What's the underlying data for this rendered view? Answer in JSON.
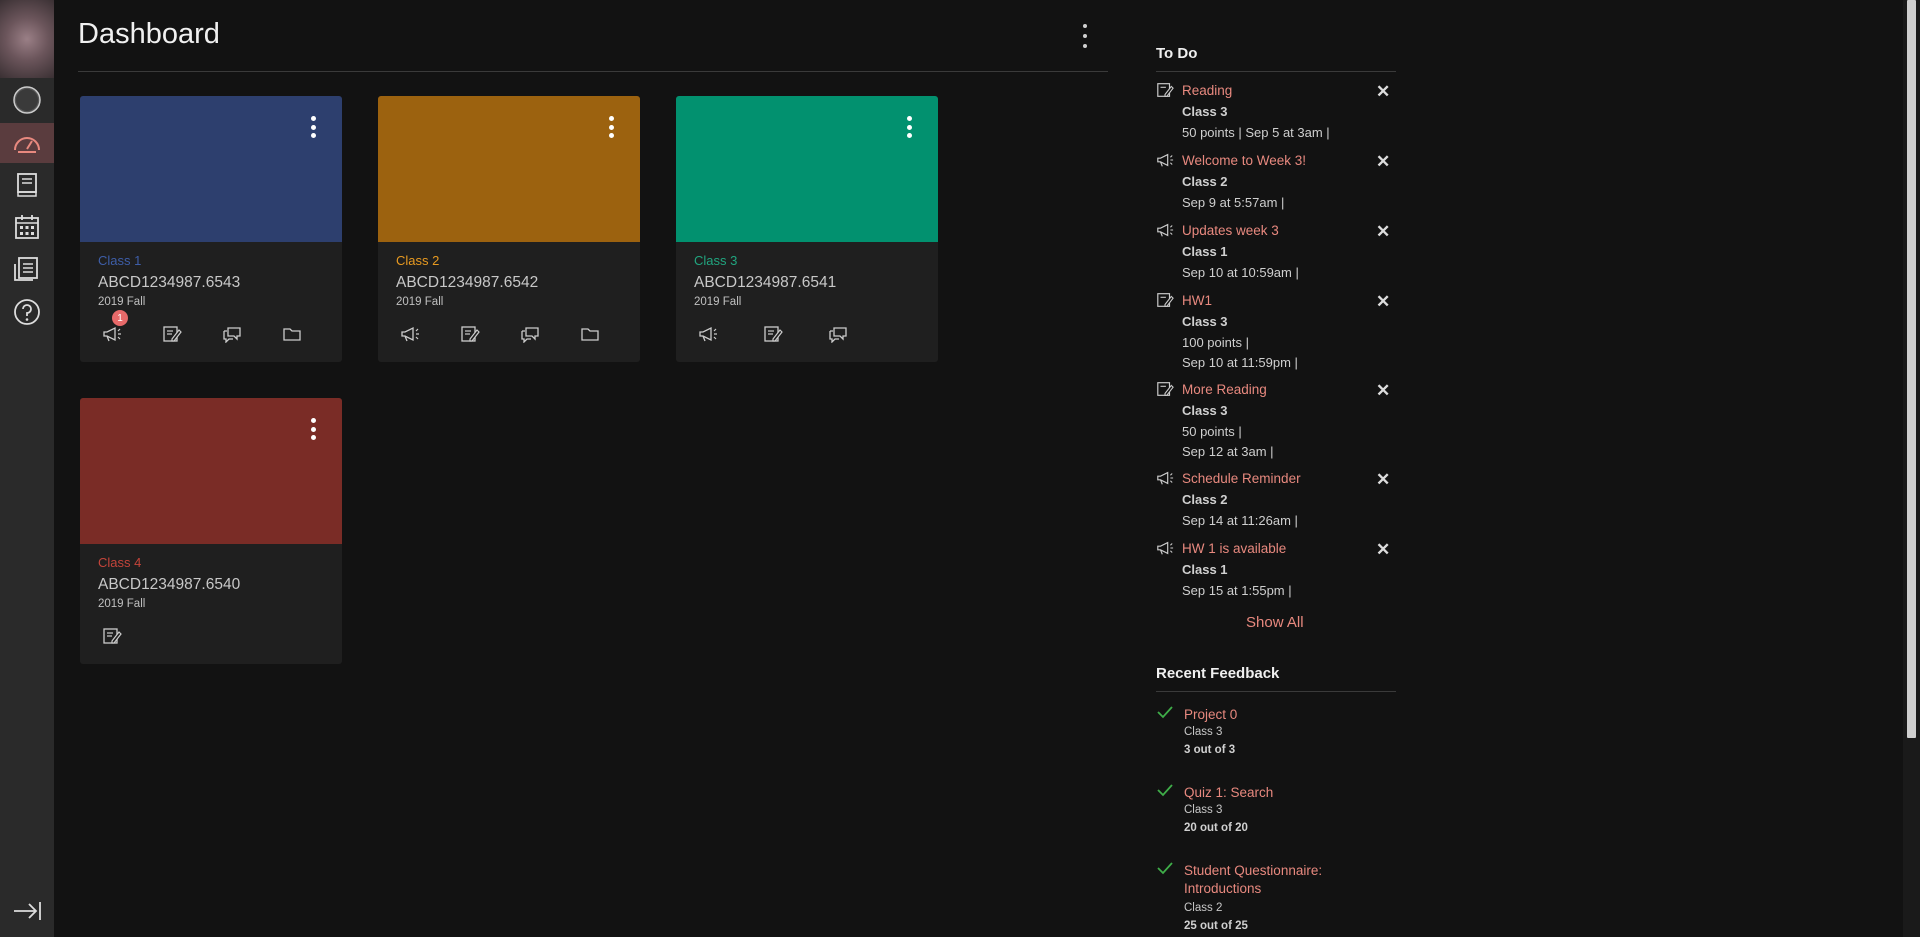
{
  "nav": {
    "items": [
      "account-icon",
      "dashboard-icon",
      "courses-icon",
      "calendar-icon",
      "inbox-icon",
      "help-icon"
    ]
  },
  "page": {
    "title": "Dashboard"
  },
  "cards": [
    {
      "course": "Class 1",
      "code": "ABCD1234987.6543",
      "term": "2019 Fall",
      "color": "#2d3f6e",
      "link_color": "#3e5ea8",
      "badge": "1"
    },
    {
      "course": "Class 2",
      "code": "ABCD1234987.6542",
      "term": "2019 Fall",
      "color": "#9c620f",
      "link_color": "#e89a20"
    },
    {
      "course": "Class 3",
      "code": "ABCD1234987.6541",
      "term": "2019 Fall",
      "color": "#02916f",
      "link_color": "#21a57f"
    },
    {
      "course": "Class 4",
      "code": "ABCD1234987.6540",
      "term": "2019 Fall",
      "color": "#7a2c26",
      "link_color": "#c4443a"
    }
  ],
  "todo": {
    "heading": "To Do",
    "items": [
      {
        "title": "Reading",
        "class": "Class 3",
        "meta": "50 points   |   Sep 5 at 3am   |",
        "icon": "assignment-icon"
      },
      {
        "title": "Welcome to Week 3!",
        "class": "Class 2",
        "meta": "Sep 9 at 5:57am   |",
        "icon": "announcement-icon"
      },
      {
        "title": "Updates week 3",
        "class": "Class 1",
        "meta": "Sep 10 at 10:59am   |",
        "icon": "announcement-icon"
      },
      {
        "title": "HW1",
        "class": "Class 3",
        "meta": "100 points   |",
        "meta2": "Sep 10 at 11:59pm   |",
        "icon": "assignment-icon"
      },
      {
        "title": "More Reading",
        "class": "Class 3",
        "meta": "50 points   |",
        "meta2": "Sep 12 at 3am   |",
        "icon": "assignment-icon"
      },
      {
        "title": "Schedule Reminder",
        "class": "Class 2",
        "meta": "Sep 14 at 11:26am   |",
        "icon": "announcement-icon"
      },
      {
        "title": "HW 1 is available",
        "class": "Class 1",
        "meta": "Sep 15 at 1:55pm   |",
        "icon": "announcement-icon"
      }
    ],
    "show_all": "Show All"
  },
  "feedback": {
    "heading": "Recent Feedback",
    "items": [
      {
        "title": "Project 0",
        "class": "Class 3",
        "score": "3 out of 3"
      },
      {
        "title": "Quiz 1: Search",
        "class": "Class 3",
        "score": "20 out of 20"
      },
      {
        "title": "Student Questionnaire: Introductions",
        "class": "Class 2",
        "score": "25 out of 25"
      }
    ]
  },
  "colors": {
    "accent": "#e8897f",
    "check": "#3fae49"
  }
}
